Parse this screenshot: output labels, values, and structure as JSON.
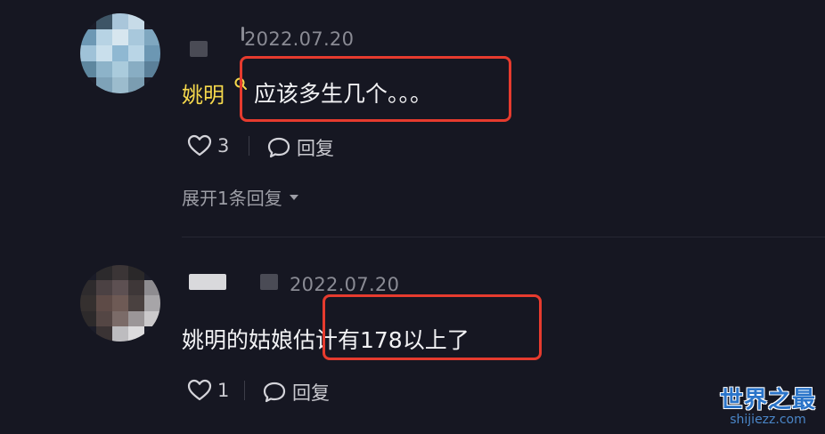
{
  "comments": [
    {
      "date": "2022.07.20",
      "author": "姚明",
      "text": "应该多生几个。。。",
      "likes": "3",
      "reply_label": "回复",
      "expand_label": "展开1条回复"
    },
    {
      "date": "2022.07.20",
      "text": "姚明的姑娘估计有178以上了",
      "likes": "1",
      "reply_label": "回复"
    }
  ],
  "watermark": {
    "title": "世界之最",
    "url": "shijiezz.com"
  },
  "colors": {
    "background": "#161722",
    "author": "#f6d94c",
    "highlight": "#e63b2e",
    "watermark": "#2a74c9"
  },
  "icons": [
    "heart-icon",
    "comment-bubble-icon",
    "search-icon",
    "caret-down-icon"
  ]
}
